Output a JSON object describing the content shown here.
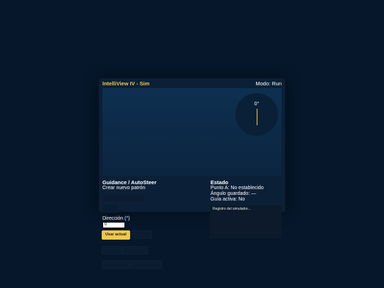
{
  "app": {
    "title": "IntelliView IV - Sim",
    "mode_label": "Modo:",
    "mode_value": "Run"
  },
  "compass": {
    "heading_label": "0°",
    "heading_deg": 0
  },
  "guidance": {
    "heading": "Guidance / AutoSteer",
    "subtitle": "Crear nuevo patrón",
    "direction_label": "Dirección (°)",
    "direction_value": "0",
    "use_current_button": "Usar actual",
    "faded_buttons": [
      "",
      "",
      "",
      "",
      "",
      "",
      "",
      ""
    ]
  },
  "status": {
    "heading": "Estado",
    "point_a": "Punto A: No establecido",
    "saved_angle": "Ángulo guardado: —",
    "active_guide": "Guía activa: No"
  },
  "log": {
    "placeholder": "Registro del simulador..."
  },
  "colors": {
    "accent": "#f2c84b",
    "background": "#06172b",
    "panel": "#0b2036"
  }
}
